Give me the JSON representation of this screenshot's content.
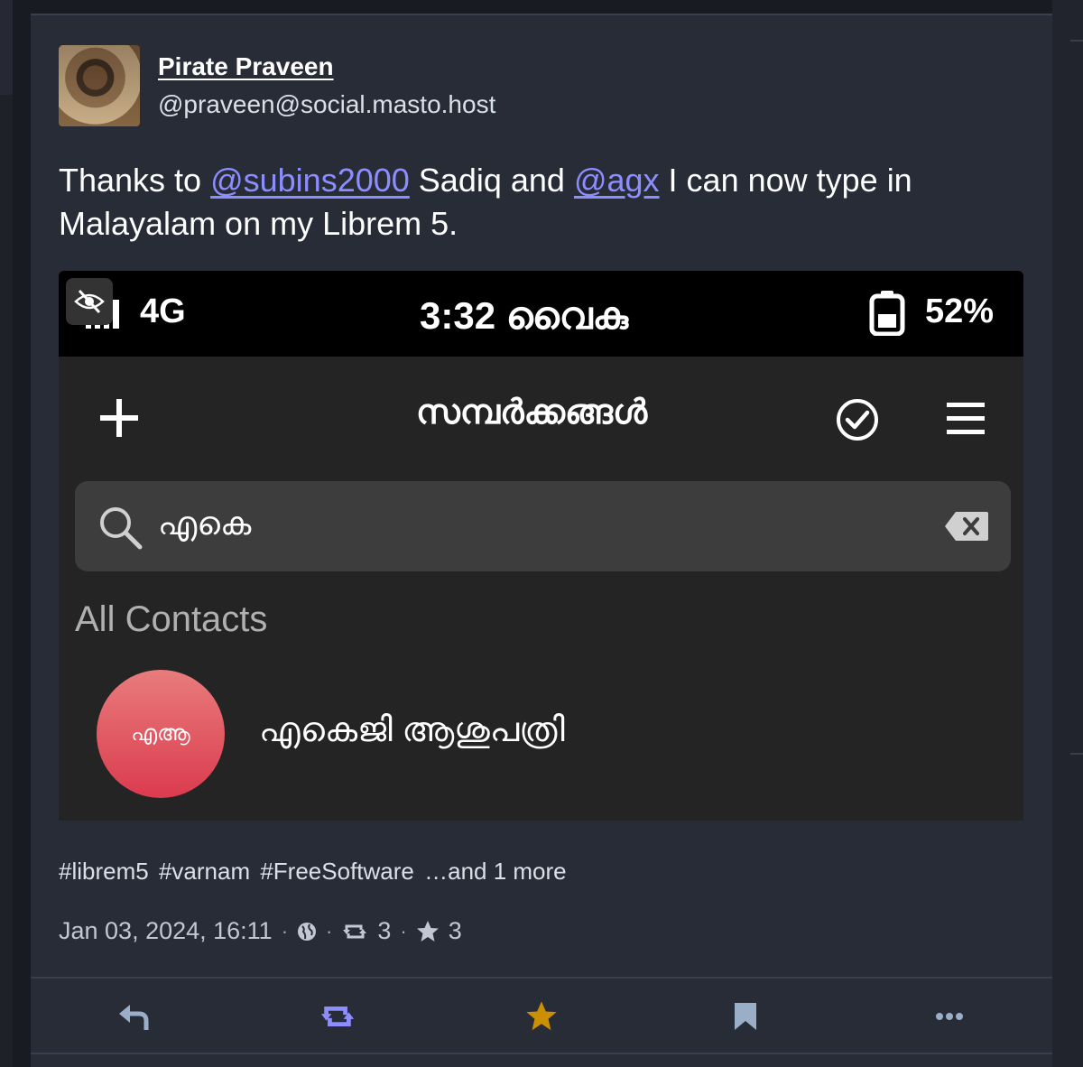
{
  "author": {
    "display_name": "Pirate Praveen",
    "handle": "@praveen@social.masto.host"
  },
  "status": {
    "text_before": "Thanks to ",
    "mention1": "@subins2000",
    "text_mid": " Sadiq and ",
    "mention2": "@agx",
    "text_after": " I can now type in Malayalam on my Librem 5.",
    "hashtags": [
      "#librem5",
      "#varnam",
      "#FreeSoftware",
      "…and 1 more"
    ],
    "timestamp": "Jan 03, 2024, 16:11",
    "boost_count": "3",
    "favourite_count": "3"
  },
  "media": {
    "statusbar": {
      "network": "4G",
      "clock": "3:32 വൈകു",
      "battery": "52%"
    },
    "app_title": "സമ്പർക്കങ്ങൾ",
    "search_value": "എകെ",
    "section_label": "All Contacts",
    "contact": {
      "initials": "എആ",
      "name": "എകെജി ആശുപത്രി"
    }
  },
  "colors": {
    "background": "#191b22",
    "card": "#282c37",
    "mention": "#8c8dff",
    "boost_active": "#8c8dff",
    "favourite_active": "#ca8f04",
    "icon_muted": "#9baec8"
  },
  "icons": {
    "visibility": "globe-icon",
    "boost": "retweet-icon",
    "favourite": "star-icon",
    "reply": "reply-icon",
    "bookmark": "bookmark-icon",
    "more": "ellipsis-icon",
    "sensitive": "eye-slash-icon"
  }
}
